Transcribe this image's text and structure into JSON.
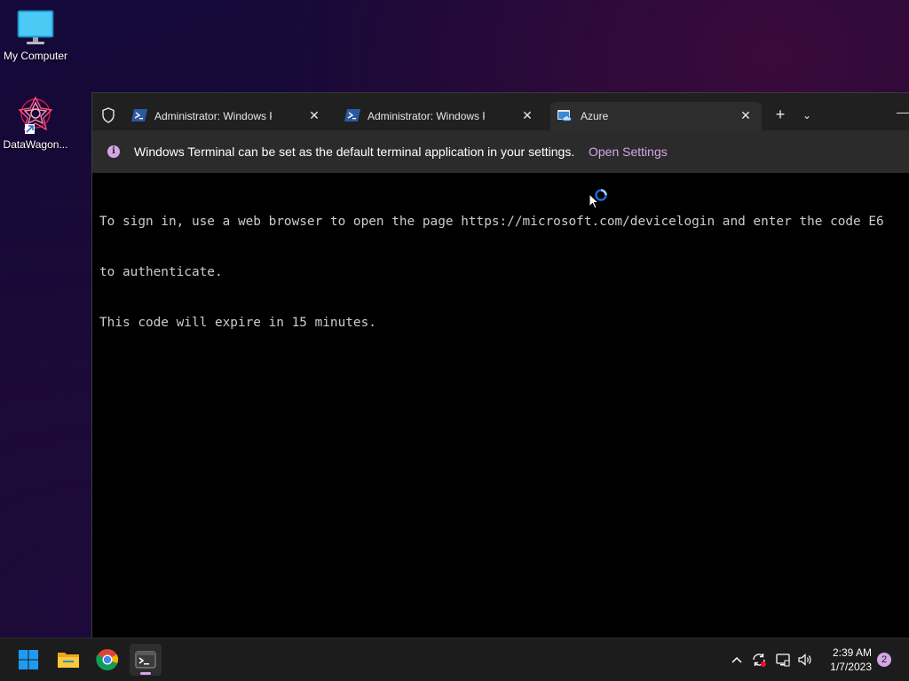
{
  "desktop": {
    "icons": [
      {
        "label": "My Computer",
        "icon": "monitor-icon"
      },
      {
        "label": "DataWagon...",
        "icon": "datawagon-app-icon"
      }
    ]
  },
  "terminal": {
    "tabs": [
      {
        "title": "Administrator: Windows PowerShell",
        "icon": "powershell-icon",
        "active": false
      },
      {
        "title": "Administrator: Windows PowerShell",
        "icon": "powershell-icon",
        "active": false
      },
      {
        "title": "Azure",
        "icon": "azure-cloud-shell-icon",
        "active": true
      }
    ],
    "new_tab": "+",
    "dropdown": "⌄",
    "minimize": "—",
    "close_glyph": "✕",
    "infobar": {
      "message": "Windows Terminal can be set as the default terminal application in your settings.",
      "link": "Open Settings"
    },
    "console_lines": [
      "To sign in, use a web browser to open the page https://microsoft.com/devicelogin and enter the code E6",
      "to authenticate.",
      "This code will expire in 15 minutes."
    ]
  },
  "taskbar": {
    "apps": [
      {
        "name": "Start",
        "icon": "windows-start-icon"
      },
      {
        "name": "File Explorer",
        "icon": "folder-icon"
      },
      {
        "name": "Google Chrome",
        "icon": "chrome-icon"
      },
      {
        "name": "Windows Terminal",
        "icon": "terminal-icon",
        "active": true
      }
    ],
    "tray": {
      "chevron": "^",
      "time": "2:39 AM",
      "date": "1/7/2023",
      "notification_count": "2"
    }
  },
  "colors": {
    "accent": "#d5a6e8",
    "tabbar": "#202020",
    "active_tab": "#2d2d2d",
    "infobar": "#2b2b2b",
    "console_text": "#cccccc"
  }
}
